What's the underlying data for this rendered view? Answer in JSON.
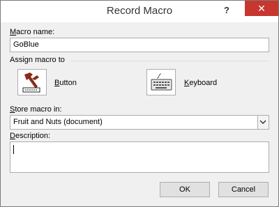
{
  "window": {
    "title": "Record Macro"
  },
  "controls": {
    "help": "?",
    "close": "✕"
  },
  "macro_name": {
    "label_prefix": "",
    "label_access": "M",
    "label_rest": "acro name:",
    "value": "GoBlue"
  },
  "assign": {
    "label": "Assign macro to",
    "button": {
      "label_access": "B",
      "label_rest": "utton",
      "icon": "hammer-icon"
    },
    "keyboard": {
      "label_access": "K",
      "label_rest": "eyboard",
      "icon": "keyboard-icon"
    }
  },
  "store": {
    "label_prefix": "",
    "label_access": "S",
    "label_rest": "tore macro in:",
    "value": "Fruit and Nuts (document)"
  },
  "description": {
    "label_prefix": "",
    "label_access": "D",
    "label_rest": "escription:",
    "value": ""
  },
  "buttons": {
    "ok": "OK",
    "cancel": "Cancel"
  },
  "colors": {
    "close_bg": "#c7372f",
    "dialog_bg": "#f0f0f0",
    "button_bg": "#e1e1e1"
  }
}
